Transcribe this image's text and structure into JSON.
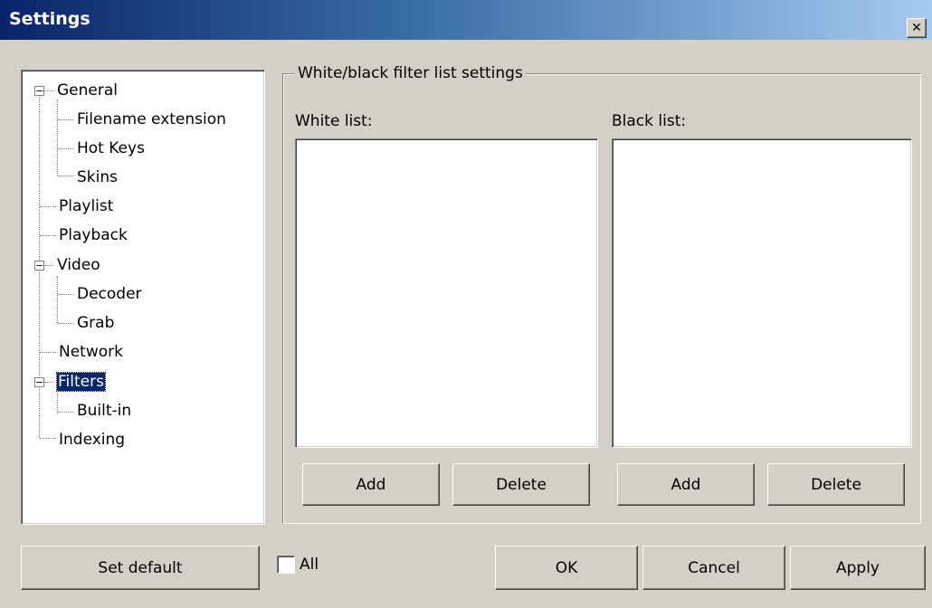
{
  "window": {
    "title": "Settings",
    "close_glyph": "✕"
  },
  "tree": {
    "items": [
      {
        "label": "General",
        "expander": "−"
      },
      {
        "label": "Filename extension"
      },
      {
        "label": "Hot Keys"
      },
      {
        "label": "Skins"
      },
      {
        "label": "Playlist"
      },
      {
        "label": "Playback"
      },
      {
        "label": "Video",
        "expander": "−"
      },
      {
        "label": "Decoder"
      },
      {
        "label": "Grab"
      },
      {
        "label": "Network"
      },
      {
        "label": "Filters",
        "expander": "−",
        "selected": true
      },
      {
        "label": "Built-in"
      },
      {
        "label": "Indexing"
      }
    ]
  },
  "filters": {
    "group_title": "White/black filter list settings",
    "white_label": "White list:",
    "black_label": "Black list:",
    "white_add": "Add",
    "white_delete": "Delete",
    "black_add": "Add",
    "black_delete": "Delete"
  },
  "footer": {
    "set_default": "Set default",
    "all_label": "All",
    "all_checked": false,
    "ok": "OK",
    "cancel": "Cancel",
    "apply": "Apply"
  },
  "colors": {
    "titlebar_start": "#0a246a",
    "titlebar_end": "#a6caf0",
    "face": "#d4d0c8",
    "selection": "#0a246a"
  }
}
